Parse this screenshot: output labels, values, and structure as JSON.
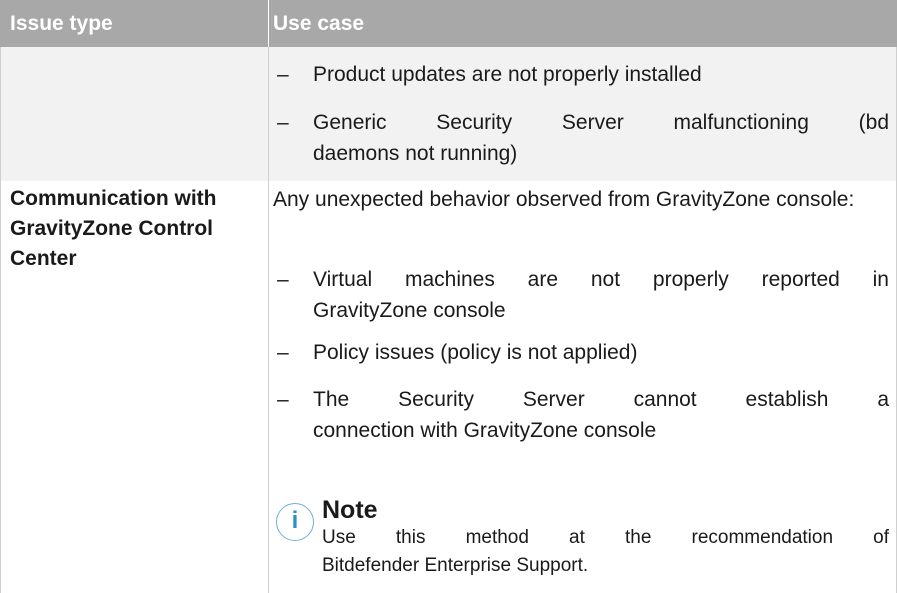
{
  "table": {
    "headers": {
      "issue_type": "Issue type",
      "use_case": "Use case"
    },
    "continued_row": {
      "items": [
        "Product updates are not properly installed",
        "Generic Security Server malfunctioning (bd daemons not running)"
      ]
    },
    "row": {
      "issue_type": "Communication with GravityZone Control Center",
      "intro": "Any unexpected behavior observed from GravityZone console:",
      "items": [
        "Virtual machines are not properly reported in GravityZone console",
        "Policy issues (policy is not applied)",
        "The Security Server cannot establish a connection with GravityZone console"
      ],
      "note": {
        "icon": "info-icon",
        "icon_glyph": "i",
        "title": "Note",
        "body_line1": "Use this method at the recommendation of",
        "body_line2": "Bitdefender Enterprise Support."
      }
    },
    "dash": "–",
    "colors": {
      "header_bg": "#a8a8a8",
      "shaded_row": "#f2f2f2",
      "note_icon": "#2f8fc4"
    }
  }
}
